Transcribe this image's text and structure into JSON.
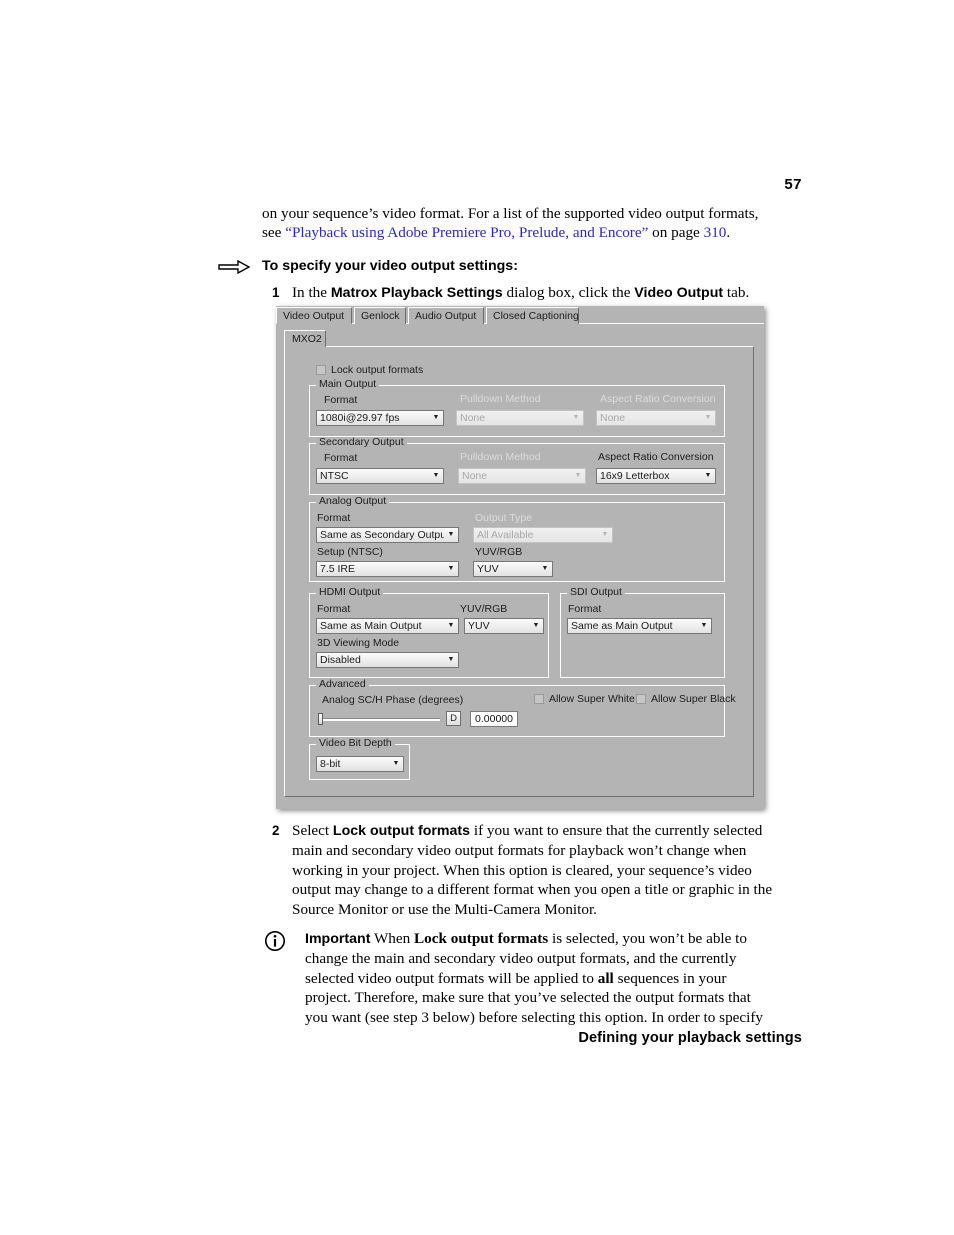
{
  "page": {
    "number": "57",
    "footer": "Defining your playback settings"
  },
  "intro": {
    "line1": "on your sequence’s video format. For a list of the supported video output formats,",
    "line2_pre": "see ",
    "link": "“Playback using Adobe Premiere Pro, Prelude, and Encore”",
    "line2_mid": " on page ",
    "page_ref": "310",
    "line2_end": "."
  },
  "procedure": {
    "heading": "To specify your video output settings:",
    "steps": [
      {
        "num": "1",
        "pre": "In the ",
        "b1": "Matrox Playback Settings",
        "mid": " dialog box, click the ",
        "b2": "Video Output",
        "post": " tab."
      },
      {
        "num": "2",
        "pre": "Select ",
        "b1": "Lock output formats",
        "post": " if you want to ensure that the currently selected main and secondary video output formats for playback won’t change when working in your project. When this option is cleared, your sequence’s video output may change to a different format when you open a title or graphic in the Source Monitor or use the Multi-Camera Monitor."
      }
    ]
  },
  "note": {
    "lead": "Important",
    "pre": "   When ",
    "b1": "Lock output formats",
    "mid": " is selected, you won’t be able to change the main and secondary video output formats, and the currently selected video output formats will be applied to ",
    "b2": "all",
    "post": " sequences in your project. Therefore, make sure that you’ve selected the output formats that you want (see step 3 below) before selecting this option. In order to specify"
  },
  "dialog": {
    "tabs": [
      {
        "label": "Video Output",
        "active": true
      },
      {
        "label": "Genlock",
        "active": false
      },
      {
        "label": "Audio Output",
        "active": false
      },
      {
        "label": "Closed Captioning",
        "active": false
      }
    ],
    "subtab": "MXO2",
    "lock_output_formats": {
      "label": "Lock output formats",
      "checked": false
    },
    "main_output": {
      "title": "Main Output",
      "format_label": "Format",
      "format_value": "1080i@29.97 fps",
      "pulldown_label": "Pulldown Method",
      "pulldown_value": "None",
      "pulldown_disabled": true,
      "aspect_label": "Aspect Ratio Conversion",
      "aspect_value": "None",
      "aspect_disabled": true
    },
    "secondary_output": {
      "title": "Secondary Output",
      "format_label": "Format",
      "format_value": "NTSC",
      "pulldown_label": "Pulldown Method",
      "pulldown_value": "None",
      "pulldown_disabled": true,
      "aspect_label": "Aspect Ratio Conversion",
      "aspect_value": "16x9 Letterbox",
      "aspect_disabled": false
    },
    "analog_output": {
      "title": "Analog Output",
      "format_label": "Format",
      "format_value": "Same as Secondary Output",
      "output_type_label": "Output Type",
      "output_type_value": "All Available",
      "output_type_disabled": true,
      "setup_label": "Setup (NTSC)",
      "setup_value": "7.5 IRE",
      "yuvrgb_label": "YUV/RGB",
      "yuvrgb_value": "YUV"
    },
    "hdmi_output": {
      "title": "HDMI Output",
      "format_label": "Format",
      "format_value": "Same as Main Output",
      "yuvrgb_label": "YUV/RGB",
      "yuvrgb_value": "YUV",
      "viewing_label": "3D Viewing Mode",
      "viewing_value": "Disabled"
    },
    "sdi_output": {
      "title": "SDI Output",
      "format_label": "Format",
      "format_value": "Same as Main Output"
    },
    "advanced": {
      "title": "Advanced",
      "phase_label": "Analog SC/H Phase (degrees)",
      "default_button": "D",
      "phase_value": "0.00000",
      "slider_position_pct": 0,
      "super_white_label": "Allow Super White",
      "super_white_checked": false,
      "super_black_label": "Allow Super Black",
      "super_black_checked": false
    },
    "video_bit_depth": {
      "title": "Video Bit Depth",
      "value": "8-bit"
    }
  }
}
